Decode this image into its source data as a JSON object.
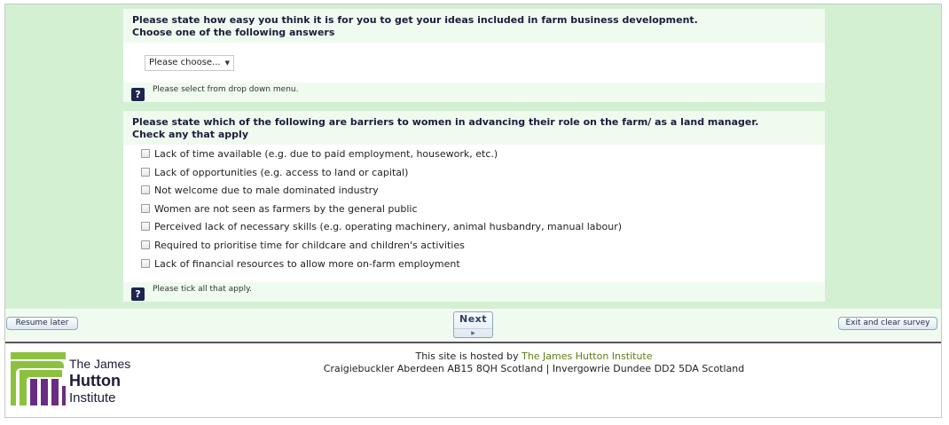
{
  "question1": {
    "title": "Please state how easy you think it is for you to get your ideas included in farm business development.",
    "instruction": "Choose one of the following answers",
    "select_value": "Please choose...",
    "help": "Please select from drop down menu."
  },
  "question2": {
    "title": "Please state which of the following are barriers to women in advancing their role on the farm/ as a land manager.",
    "instruction": "Check any that apply",
    "options": [
      "Lack of time available (e.g. due to paid employment, housework, etc.)",
      "Lack of opportunities (e.g. access to land or capital)",
      "Not welcome due to male dominated industry",
      "Women are not seen as farmers by the general public",
      "Perceived lack of necessary skills (e.g. operating machinery, animal husbandry, manual labour)",
      "Required to prioritise time for childcare and children's activities",
      "Lack of financial resources to allow more on-farm employment"
    ],
    "help": "Please tick all that apply."
  },
  "help_symbol": "?",
  "navigation": {
    "resume_label": "Resume later",
    "next_label": "Next",
    "exit_label": "Exit and clear survey"
  },
  "footer": {
    "hosted_prefix": "This site is hosted by ",
    "host_name": "The James Hutton Institute",
    "address": "Craigiebuckler Aberdeen AB15 8QH Scotland | Invergowrie Dundee DD2 5DA Scotland",
    "logo_line1": "The James",
    "logo_line2": "Hutton",
    "logo_line3": "Institute"
  },
  "colors": {
    "survey_background": "#d3f0d3",
    "header_band": "#f0fbf0",
    "help_icon": "#1e2450",
    "link_green": "#5a7f12",
    "logo_green": "#8cc13f",
    "logo_purple": "#6a2c82"
  }
}
